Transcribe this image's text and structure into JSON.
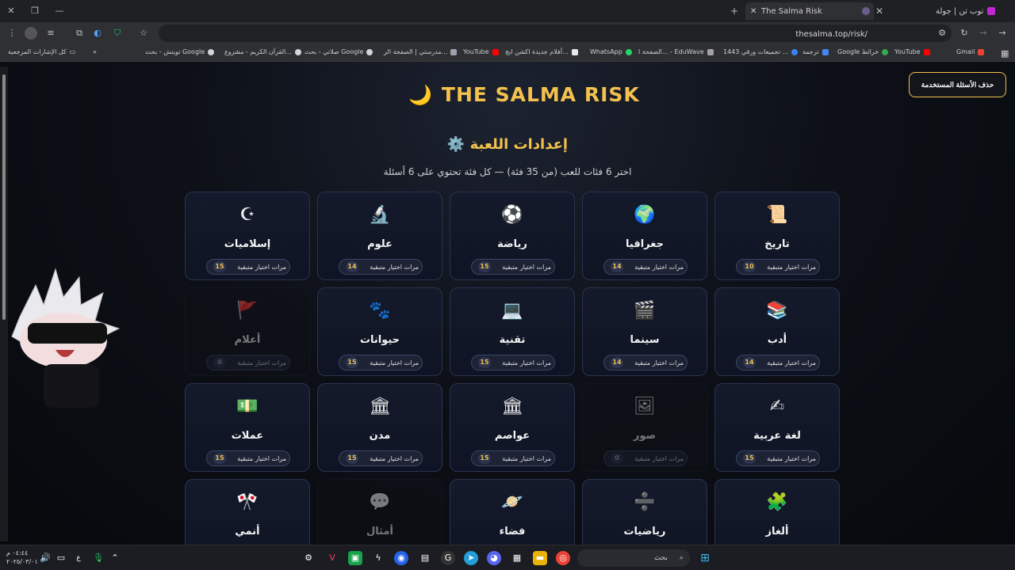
{
  "browser": {
    "tabs": [
      {
        "title": "توب تن | جولة",
        "active": false
      },
      {
        "title": "The Salma Risk",
        "active": true
      }
    ],
    "new_tab_glyph": "+",
    "url": "thesalma.top/risk/",
    "bookmarks_all_label": "كل الإشارات المرجعية",
    "bookmarks": [
      {
        "label": "Gmail",
        "color": "#ea4335"
      },
      {
        "label": "YouTube",
        "color": "#ff0000"
      },
      {
        "label": "Google خرائط",
        "color": "#34a853"
      },
      {
        "label": "ترجمة",
        "color": "#4285f4"
      },
      {
        "label": "تجميعات ورقي 1443 ...",
        "color": "#3b82f6"
      },
      {
        "label": "الصفحة ا... - EduWave",
        "color": "#a3a3a3"
      },
      {
        "label": "WhatsApp",
        "color": "#25d366"
      },
      {
        "label": "أفلام جديدة اكشن ايج...",
        "color": "#e5e7eb"
      },
      {
        "label": "YouTube",
        "color": "#ff0000"
      },
      {
        "label": "مدرستي | الصفحة الر...",
        "color": "#9ca3af"
      },
      {
        "label": "صلاتي - بحث Google",
        "color": "#d1d5db"
      },
      {
        "label": "القرآن الكريم - مشروع...",
        "color": "#d1d5db"
      },
      {
        "label": "تويتش - بحث Google",
        "color": "#d1d5db"
      }
    ]
  },
  "page": {
    "logo_text": "THE SALMA RISK",
    "logo_icon": "moon-icon",
    "delete_button": "حذف الأسئلة المستخدمة",
    "settings_title": "⚙️ إعدادات اللعبة",
    "settings_subtitle": "اختر 6 فئات للعب (من 35 فئة) — كل فئة تحتوي على 6 أسئلة",
    "accent_color": "#f2c14e",
    "categories": [
      {
        "label": "تاريخ",
        "icon": "📜",
        "icon_name": "scroll-icon",
        "pill": "مرات اختيار متبقية",
        "count": "10",
        "disabled": false
      },
      {
        "label": "جغرافيا",
        "icon": "🌍",
        "icon_name": "globe-icon",
        "pill": "مرات اختيار متبقية",
        "count": "14",
        "disabled": false
      },
      {
        "label": "رياضة",
        "icon": "⚽",
        "icon_name": "soccer-ball-icon",
        "pill": "مرات اختيار متبقية",
        "count": "15",
        "disabled": false
      },
      {
        "label": "علوم",
        "icon": "🔬",
        "icon_name": "microscope-icon",
        "pill": "مرات اختيار متبقية",
        "count": "14",
        "disabled": false
      },
      {
        "label": "إسلاميات",
        "icon": "☪",
        "icon_name": "star-crescent-icon",
        "pill": "مرات اختيار متبقية",
        "count": "15",
        "disabled": false
      },
      {
        "label": "أدب",
        "icon": "📚",
        "icon_name": "books-icon",
        "pill": "مرات اختيار متبقية",
        "count": "14",
        "disabled": false
      },
      {
        "label": "سينما",
        "icon": "🎬",
        "icon_name": "clapperboard-icon",
        "pill": "مرات اختيار متبقية",
        "count": "14",
        "disabled": false
      },
      {
        "label": "تقنية",
        "icon": "💻",
        "icon_name": "laptop-icon",
        "pill": "مرات اختيار متبقية",
        "count": "15",
        "disabled": false
      },
      {
        "label": "حيوانات",
        "icon": "🐾",
        "icon_name": "paw-icon",
        "pill": "مرات اختيار متبقية",
        "count": "15",
        "disabled": false
      },
      {
        "label": "أعلام",
        "icon": "🚩",
        "icon_name": "flag-icon",
        "pill": "مرات اختيار متبقية",
        "count": "0",
        "disabled": true
      },
      {
        "label": "لغة عربية",
        "icon": "✍",
        "icon_name": "writing-hand-icon",
        "pill": "مرات اختيار متبقية",
        "count": "15",
        "disabled": false
      },
      {
        "label": "صور",
        "icon": "🖼",
        "icon_name": "picture-icon",
        "pill": "مرات اختيار متبقية",
        "count": "0",
        "disabled": true
      },
      {
        "label": "عواصم",
        "icon": "🏛",
        "icon_name": "classical-building-icon",
        "pill": "مرات اختيار متبقية",
        "count": "15",
        "disabled": false
      },
      {
        "label": "مدن",
        "icon": "🏛",
        "icon_name": "classical-building-icon",
        "pill": "مرات اختيار متبقية",
        "count": "15",
        "disabled": false
      },
      {
        "label": "عملات",
        "icon": "💵",
        "icon_name": "banknote-icon",
        "pill": "مرات اختيار متبقية",
        "count": "15",
        "disabled": false
      },
      {
        "label": "ألغاز",
        "icon": "🧩",
        "icon_name": "puzzle-icon",
        "pill": "",
        "count": "",
        "disabled": false
      },
      {
        "label": "رياضيات",
        "icon": "➗",
        "icon_name": "divide-icon",
        "pill": "",
        "count": "",
        "disabled": false
      },
      {
        "label": "فضاء",
        "icon": "🪐",
        "icon_name": "planet-icon",
        "pill": "",
        "count": "",
        "disabled": false
      },
      {
        "label": "أمثال",
        "icon": "💬",
        "icon_name": "speech-bubble-icon",
        "pill": "",
        "count": "",
        "disabled": true
      },
      {
        "label": "أنمي",
        "icon": "🎌",
        "icon_name": "crossed-flags-icon",
        "pill": "",
        "count": "",
        "disabled": false
      }
    ]
  },
  "taskbar": {
    "search_placeholder": "بحث",
    "time": "٠٤:٤٤ م",
    "date": "٢٠٢٥/٠٣/٠١",
    "lang": "ع"
  }
}
